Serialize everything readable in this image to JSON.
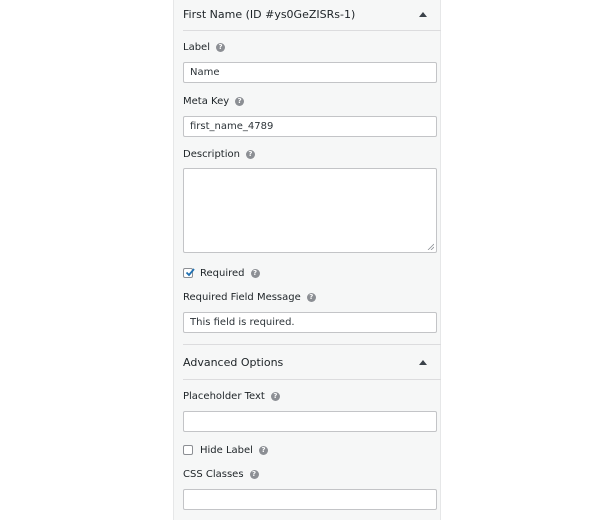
{
  "field": {
    "header_title": "First Name (ID #ys0GeZISRs-1)",
    "label": {
      "label": "Label",
      "value": "Name"
    },
    "meta_key": {
      "label": "Meta Key",
      "value": "first_name_4789"
    },
    "description": {
      "label": "Description",
      "value": ""
    },
    "required": {
      "label": "Required",
      "checked": true
    },
    "required_message": {
      "label": "Required Field Message",
      "value": "This field is required."
    }
  },
  "advanced": {
    "header_title": "Advanced Options",
    "placeholder": {
      "label": "Placeholder Text",
      "value": ""
    },
    "hide_label": {
      "label": "Hide Label",
      "checked": false
    },
    "css_classes": {
      "label": "CSS Classes",
      "value": ""
    }
  },
  "icons": {
    "help": "question-circle-icon",
    "collapse": "caret-up-icon",
    "check": "checkmark-icon"
  },
  "colors": {
    "panel_bg": "#f6f7f7",
    "accent": "#2271b1",
    "help_icon": "#8c8f94"
  }
}
